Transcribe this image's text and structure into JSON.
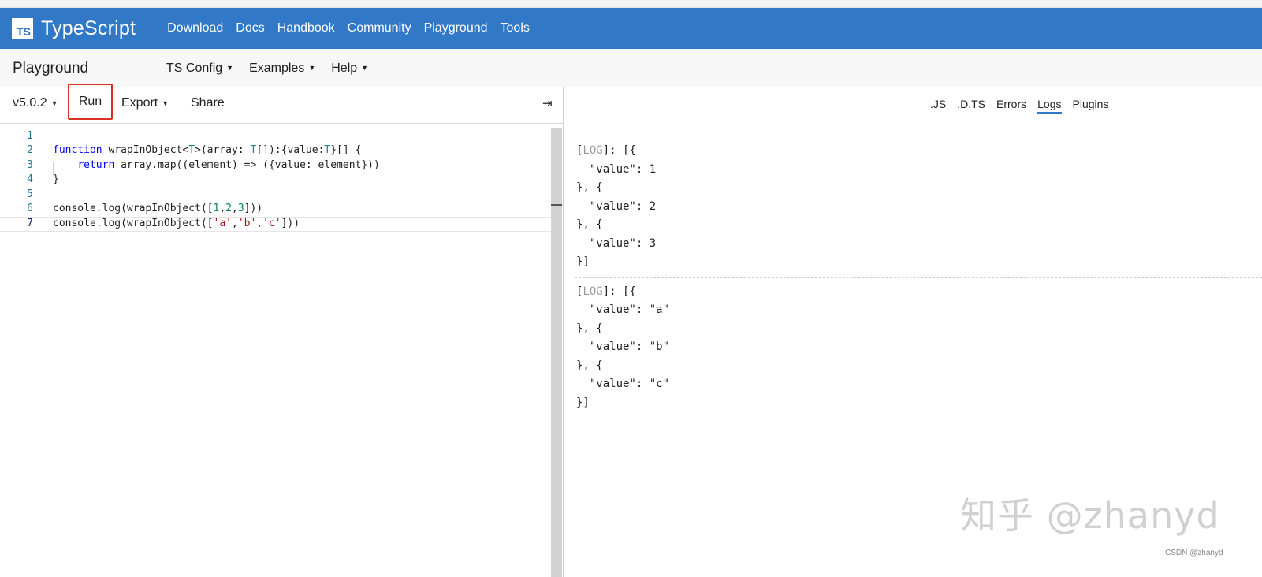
{
  "header": {
    "logo_mark": "TS",
    "logo_text": "TypeScript",
    "nav": [
      "Download",
      "Docs",
      "Handbook",
      "Community",
      "Playground",
      "Tools"
    ]
  },
  "subbar": {
    "title": "Playground",
    "menus": [
      "TS Config",
      "Examples",
      "Help"
    ]
  },
  "toolbar": {
    "version": "v5.0.2",
    "run": "Run",
    "export": "Export",
    "share": "Share",
    "collapse_glyph": "⇥"
  },
  "editor": {
    "line_numbers": [
      "1",
      "2",
      "3",
      "4",
      "5",
      "6",
      "7"
    ],
    "lines": [
      "",
      "function wrapInObject<T>(array: T[]):{value:T}[] {",
      "    return array.map((element) => ({value: element}))",
      "}",
      "",
      "console.log(wrapInObject([1,2,3]))",
      "console.log(wrapInObject(['a','b','c']))"
    ]
  },
  "output": {
    "tabs": [
      ".JS",
      ".D.TS",
      "Errors",
      "Logs",
      "Plugins"
    ],
    "active_tab": "Logs",
    "logs": [
      {
        "tag": "LOG",
        "body": ": [{\n  \"value\": 1\n}, {\n  \"value\": 2\n}, {\n  \"value\": 3\n}]"
      },
      {
        "tag": "LOG",
        "body": ": [{\n  \"value\": \"a\"\n}, {\n  \"value\": \"b\"\n}, {\n  \"value\": \"c\"\n}]"
      }
    ]
  },
  "watermark": {
    "text": "知乎 @zhanyd",
    "credit": "CSDN @zhanyd"
  },
  "colors": {
    "brand": "#3178c6",
    "run_highlight": "#d93025"
  }
}
